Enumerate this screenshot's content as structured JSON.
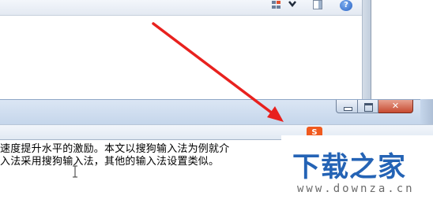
{
  "colors": {
    "accent": "#e8211e",
    "watermark_blue": "#2463b5",
    "ime_orange": "#f05a1e"
  },
  "back_window": {
    "toolbar_icons": [
      "view-options-icon",
      "chevron-down-icon",
      "preview-pane-icon",
      "help-icon"
    ],
    "help_glyph": "?"
  },
  "front_window": {
    "caption_buttons": [
      "minimize",
      "maximize",
      "close"
    ],
    "ime_icon_glyph": "S"
  },
  "document": {
    "line_1": "速度提升水平的激励。本文以搜狗输入法为例就介",
    "line_2": "入法采用搜狗输入法，其他的输入法设置类似。"
  },
  "watermark": {
    "title": "下载之家",
    "url": "www.downza.cn"
  }
}
